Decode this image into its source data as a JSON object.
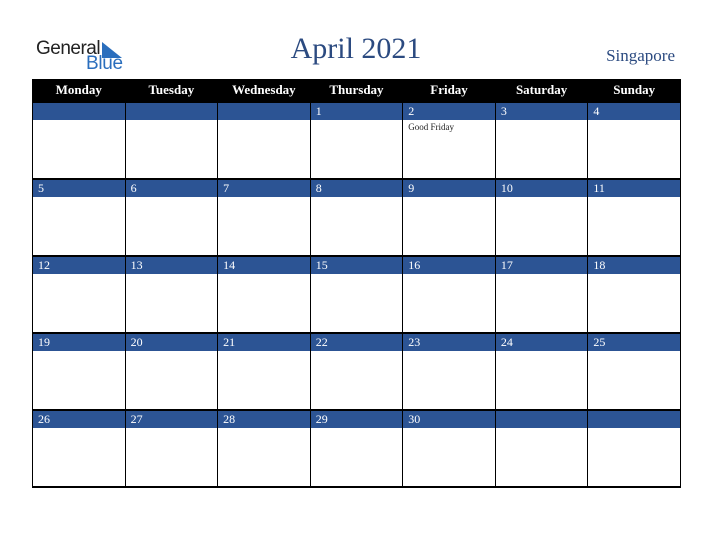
{
  "logo": {
    "word1": "General",
    "word2": "Blue"
  },
  "title": "April 2021",
  "country": "Singapore",
  "colors": {
    "header_bg": "#000000",
    "day_bar": "#2c5494",
    "title": "#2b4a80",
    "logo_blue": "#2a6ebd"
  },
  "weekdays": [
    "Monday",
    "Tuesday",
    "Wednesday",
    "Thursday",
    "Friday",
    "Saturday",
    "Sunday"
  ],
  "weeks": [
    [
      {
        "day": "",
        "event": ""
      },
      {
        "day": "",
        "event": ""
      },
      {
        "day": "",
        "event": ""
      },
      {
        "day": "1",
        "event": ""
      },
      {
        "day": "2",
        "event": "Good Friday"
      },
      {
        "day": "3",
        "event": ""
      },
      {
        "day": "4",
        "event": ""
      }
    ],
    [
      {
        "day": "5",
        "event": ""
      },
      {
        "day": "6",
        "event": ""
      },
      {
        "day": "7",
        "event": ""
      },
      {
        "day": "8",
        "event": ""
      },
      {
        "day": "9",
        "event": ""
      },
      {
        "day": "10",
        "event": ""
      },
      {
        "day": "11",
        "event": ""
      }
    ],
    [
      {
        "day": "12",
        "event": ""
      },
      {
        "day": "13",
        "event": ""
      },
      {
        "day": "14",
        "event": ""
      },
      {
        "day": "15",
        "event": ""
      },
      {
        "day": "16",
        "event": ""
      },
      {
        "day": "17",
        "event": ""
      },
      {
        "day": "18",
        "event": ""
      }
    ],
    [
      {
        "day": "19",
        "event": ""
      },
      {
        "day": "20",
        "event": ""
      },
      {
        "day": "21",
        "event": ""
      },
      {
        "day": "22",
        "event": ""
      },
      {
        "day": "23",
        "event": ""
      },
      {
        "day": "24",
        "event": ""
      },
      {
        "day": "25",
        "event": ""
      }
    ],
    [
      {
        "day": "26",
        "event": ""
      },
      {
        "day": "27",
        "event": ""
      },
      {
        "day": "28",
        "event": ""
      },
      {
        "day": "29",
        "event": ""
      },
      {
        "day": "30",
        "event": ""
      },
      {
        "day": "",
        "event": ""
      },
      {
        "day": "",
        "event": ""
      }
    ]
  ]
}
